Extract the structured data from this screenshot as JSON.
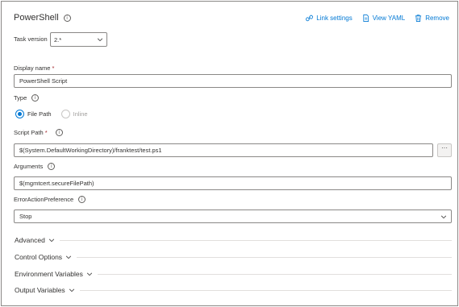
{
  "task": {
    "title": "PowerShell",
    "actions": {
      "link_settings": "Link settings",
      "view_yaml": "View YAML",
      "remove": "Remove"
    }
  },
  "task_version": {
    "label": "Task version",
    "value": "2.*"
  },
  "display_name": {
    "label": "Display name",
    "required_mark": "*",
    "value": "PowerShell Script"
  },
  "type": {
    "label": "Type",
    "options": [
      {
        "label": "File Path",
        "selected": true
      },
      {
        "label": "Inline",
        "selected": false
      }
    ]
  },
  "script_path": {
    "label": "Script Path",
    "required_mark": "*",
    "value": "$(System.DefaultWorkingDirectory)/franktest/test.ps1",
    "more_label": "···"
  },
  "arguments": {
    "label": "Arguments",
    "value": "$(mgmtcert.secureFilePath)"
  },
  "error_action": {
    "label": "ErrorActionPreference",
    "value": "Stop"
  },
  "sections": [
    {
      "label": "Advanced"
    },
    {
      "label": "Control Options"
    },
    {
      "label": "Environment Variables"
    },
    {
      "label": "Output Variables"
    }
  ],
  "colors": {
    "accent": "#0078d4",
    "required": "#a4262c",
    "border": "#8a8886"
  }
}
